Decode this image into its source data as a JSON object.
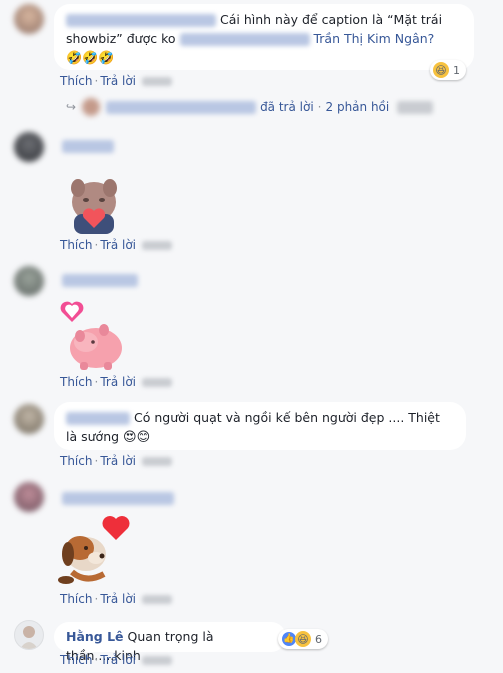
{
  "comments": [
    {
      "text_part1": "Cái hình này để caption là “Mặt trái showbiz” được ko",
      "mention": "Trần Thị Kim Ngân?",
      "emojis": "🤣🤣🤣",
      "reaction_count": "1",
      "actions": {
        "like": "Thích",
        "reply": "Trả lời"
      },
      "replies": {
        "replied": "đã trả lời",
        "count": "2 phản hồi"
      }
    },
    {
      "actions": {
        "like": "Thích",
        "reply": "Trả lời"
      }
    },
    {
      "actions": {
        "like": "Thích",
        "reply": "Trả lời"
      }
    },
    {
      "text": "Có người quạt và ngồi kế bên người đẹp .... Thiệt là sướng",
      "emojis": "😍😊",
      "actions": {
        "like": "Thích",
        "reply": "Trả lời"
      }
    },
    {
      "actions": {
        "like": "Thích",
        "reply": "Trả lời"
      }
    },
    {
      "author": "Hằng Lê",
      "text": "Quan trọng là thần.....kinh",
      "reaction_count": "6",
      "actions": {
        "like": "Thích",
        "reply": "Trả lời"
      }
    }
  ],
  "icons": [
    "reply-arrow-icon",
    "haha-reaction-icon",
    "like-reaction-icon"
  ],
  "colors": {
    "link": "#385898",
    "background": "#f6f7f9",
    "bubble": "#ffffff"
  }
}
